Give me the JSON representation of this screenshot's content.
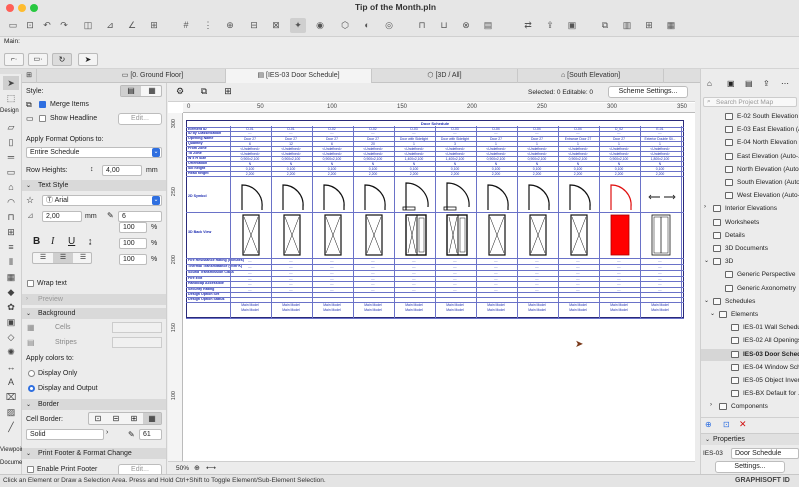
{
  "window": {
    "title": "Tip of the Month.pln",
    "traffic": {
      "close": "#ff5f57",
      "min": "#febc2e",
      "max": "#28c840"
    }
  },
  "main_label": "Main:",
  "tabs": {
    "t1": "[0. Ground Floor]",
    "t2": "[IES-03 Door Schedule]",
    "t3": "[3D / All]",
    "t4": "[South Elevation]"
  },
  "infobox": {
    "style_label": "Style:",
    "merge_items": "Merge Items",
    "show_headline": "Show Headline",
    "edit_btn": "Edit...",
    "apply_format_label": "Apply Format Options to:",
    "apply_format_value": "Entire Schedule",
    "row_heights_label": "Row Heights:",
    "row_heights_value": "4,00",
    "row_heights_unit": "mm",
    "text_style_hdr": "Text Style",
    "font_value": "Arial",
    "font_size_value": "2,00",
    "font_size_unit": "mm",
    "pen_value": "6",
    "pct1": "100",
    "pct2": "100",
    "pct3": "100",
    "pct_unit": "%",
    "wrap_text": "Wrap text",
    "preview_hdr": "Preview",
    "background_hdr": "Background",
    "cells_label": "Cells",
    "stripes_label": "Stripes",
    "apply_colors_label": "Apply colors to:",
    "display_only": "Display Only",
    "display_output": "Display and Output",
    "border_hdr": "Border",
    "cell_border_label": "Cell Border:",
    "border_line": "Solid",
    "border_pen": "61",
    "print_footer_hdr": "Print Footer & Format Change",
    "enable_print_footer": "Enable Print Footer"
  },
  "toolbox_labels": {
    "design": "Design",
    "viewpoint": "Viewpoir",
    "document": "Docume"
  },
  "docinfo": {
    "selected": "Selected: 0  Editable: 0",
    "scheme_btn": "Scheme Settings..."
  },
  "ruler": {
    "h_marks": [
      "0",
      "50",
      "100",
      "150",
      "200",
      "250",
      "300",
      "350"
    ],
    "v_marks": [
      "300",
      "250",
      "200",
      "150",
      "100"
    ]
  },
  "schedule": {
    "title": "Door Schedule",
    "row_labels": [
      "Element ID",
      "ID by Classification",
      "Opening Name",
      "Quantity",
      "From Zone",
      "To Zone",
      "W x H Size",
      "Orientation",
      "Sill height",
      "Head height",
      "2D Symbol",
      "3D Back View",
      "Fire Resistance Rating (minutes)",
      "Thermal Transmittance (W/m²K)",
      "Sound Transmission Class",
      "Fire Exit",
      "Handicap Accessible",
      "Security Rating",
      "Design Option Set",
      "Design Option Status"
    ],
    "ids": [
      "D-01",
      "D-01",
      "D-02",
      "D-02",
      "D-03",
      "D-03",
      "D-04",
      "D-04",
      "D-04",
      "D_02",
      "E-01"
    ],
    "names": [
      "Door 27",
      "Door 27",
      "Door 27",
      "Door 27",
      "Door with Sidelight",
      "Door with Sidelight",
      "Door 27",
      "Door 27",
      "Entrance Door 27",
      "Door 27",
      "Exterior Double Sli..."
    ],
    "quantities": [
      "6",
      "12",
      "6",
      "20",
      "1",
      "3",
      "1",
      "1",
      "1",
      "1",
      "1"
    ],
    "zone": "<Undefined>",
    "sizes": [
      "0,900x2,100",
      "0,900x2,100",
      "0,900x2,100",
      "0,900x2,100",
      "1,400x2,100",
      "1,400x2,100",
      "0,900x2,100",
      "0,900x2,100",
      "0,900x2,100",
      "0,900x2,100",
      "1,800x2,100"
    ],
    "orient": [
      "N",
      "N",
      "N",
      "N",
      "N",
      "N",
      "N",
      "N",
      "N",
      "N",
      "N"
    ],
    "sill": "0,100",
    "head": "2,200",
    "dash": "---",
    "option_set": "Main Model",
    "option_status": "Main Model"
  },
  "zoom": "50%",
  "status_text": "Click an Element or Draw a Selection Area. Press and Hold Ctrl+Shift to Toggle Element/Sub-Element Selection.",
  "navigator": {
    "search_placeholder": "Search Project Map",
    "items": [
      "E-02 South Elevation",
      "E-03 East Elevation (A...",
      "E-04 North Elevation",
      "East Elevation (Auto-...",
      "North Elevation (Auto-...",
      "South Elevation (Auto...",
      "West Elevation (Auto-...",
      "Interior Elevations",
      "Worksheets",
      "Details",
      "3D Documents",
      "3D",
      "Generic Perspective",
      "Generic Axonometry",
      "Schedules",
      "Elements",
      "IES-01 Wall Schedule",
      "IES-02 All Openings",
      "IES-03 Door Schedule",
      "IES-04 Window Sche...",
      "IES-05 Object Inven...",
      "IES-BX Default for ...",
      "Components"
    ],
    "properties_hdr": "Properties",
    "prop_id": "IES-03",
    "prop_name": "Door Schedule",
    "settings_btn": "Settings...",
    "brand": "GRAPHISOFT ID"
  },
  "colors": {
    "accent": "#2f6fe0",
    "schedule_text": "#1a2ab0",
    "red_door": "#ff0000"
  }
}
